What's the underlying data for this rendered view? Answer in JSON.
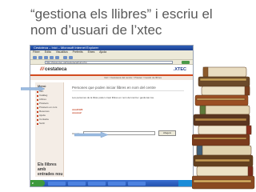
{
  "slide": {
    "title": "“gestiona els llibres” i escriu el nom d’usuari de l’xtec"
  },
  "browser": {
    "window_title": "Cestoteca – Inici – Microsoft Internet Explorer",
    "menu_items": [
      "Fitxer",
      "Edita",
      "Visualitza",
      "Preferits",
      "Eines",
      "Ajuda"
    ],
    "address": "http://www.xtec.cat/cestoteca/inici.php"
  },
  "site": {
    "brand_name": "cestateca",
    "xtec_logo": ".XTEC",
    "breadcrumb": "Inici / Cestoteca del centre / Prèstec / Gestió de llibres",
    "menu_title": "Menú",
    "menu_items": [
      "Inici",
      "Catàleg",
      "Llibres",
      "Préstecs",
      "Préstecs en curs",
      "Reserves",
      "Ajuda",
      "Contacte",
      "Sortir"
    ],
    "sidebar_note": "Els llibres amb entrades nou",
    "content_title": "Persones que poden iniciar llibres en nom del centre",
    "content_text": "Les persones de la llista poden crear llibres en nom del centre i gestionar-los.",
    "codes": [
      "xxxx0123",
      "xxxxxx2"
    ],
    "field_label": "Usuari:",
    "field_button": "Afegeix"
  },
  "colors": {
    "accent": "#c23a1a",
    "xtec_blue": "#1f3c8a",
    "arrow_blue": "#9bbbe0",
    "title_gray": "#595959"
  }
}
